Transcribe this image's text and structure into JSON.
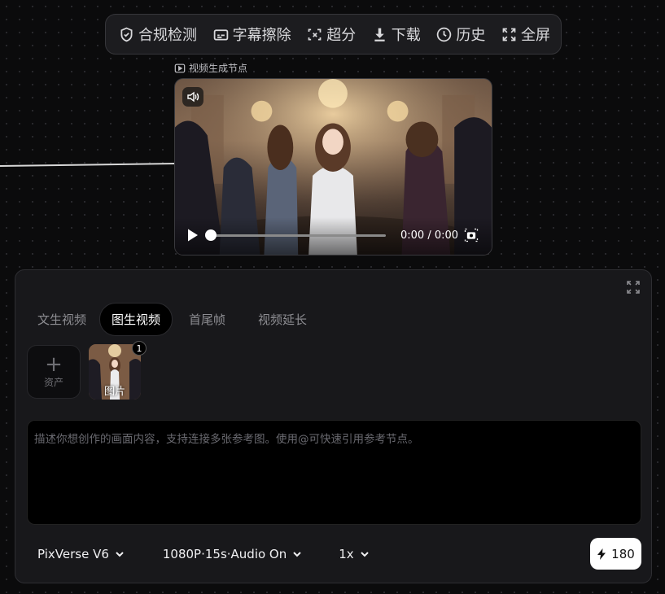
{
  "toolbar": {
    "items": [
      {
        "label": "合规检测",
        "icon": "shield-check-icon"
      },
      {
        "label": "字幕擦除",
        "icon": "subtitles-icon"
      },
      {
        "label": "超分",
        "icon": "upscale-icon"
      },
      {
        "label": "下载",
        "icon": "download-icon"
      },
      {
        "label": "历史",
        "icon": "clock-icon"
      },
      {
        "label": "全屏",
        "icon": "fullscreen-icon"
      }
    ]
  },
  "node": {
    "title": "视频生成节点",
    "title_icon": "video-icon"
  },
  "player": {
    "time": "0:00 / 0:00",
    "progress": 0
  },
  "panel": {
    "tabs": [
      {
        "label": "文生视频",
        "active": false
      },
      {
        "label": "图生视频",
        "active": true
      },
      {
        "label": "首尾帧",
        "active": false
      },
      {
        "label": "视频延长",
        "active": false
      }
    ],
    "asset_add_label": "资产",
    "image_label": "图片",
    "image_count": "1",
    "prompt_placeholder": "描述你想创作的画面内容，支持连接多张参考图。使用@可快速引用参考节点。",
    "model": "PixVerse V6",
    "settings": "1080P·15s·Audio On",
    "count": "1x",
    "credits": "180"
  },
  "colors": {
    "panel_bg": "#18181b",
    "button_bg": "#ffffff",
    "canvas_bg": "#0b0b0c"
  }
}
